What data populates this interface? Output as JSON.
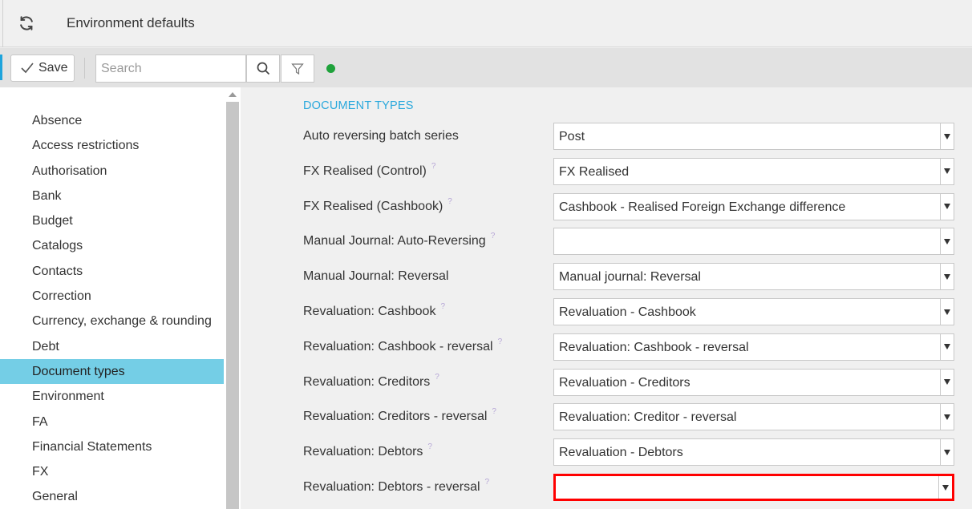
{
  "header": {
    "title": "Environment defaults",
    "refresh_icon": "refresh-icon"
  },
  "toolbar": {
    "save_label": "Save",
    "search_placeholder": "Search",
    "search_value": "",
    "status_color": "#1fa23b"
  },
  "sidebar": {
    "active_item": "Document types",
    "items": [
      {
        "label": "Absence"
      },
      {
        "label": "Access restrictions"
      },
      {
        "label": "Authorisation"
      },
      {
        "label": "Bank"
      },
      {
        "label": "Budget"
      },
      {
        "label": "Catalogs"
      },
      {
        "label": "Contacts"
      },
      {
        "label": "Correction"
      },
      {
        "label": "Currency, exchange & rounding"
      },
      {
        "label": "Debt"
      },
      {
        "label": "Document types"
      },
      {
        "label": "Environment"
      },
      {
        "label": "FA"
      },
      {
        "label": "Financial Statements"
      },
      {
        "label": "FX"
      },
      {
        "label": "General"
      }
    ]
  },
  "main": {
    "section_title": "DOCUMENT TYPES",
    "help_glyph": "?",
    "fields": [
      {
        "label": "Auto reversing batch series",
        "value": "Post",
        "help": false
      },
      {
        "label": "FX Realised (Control)",
        "value": "FX Realised",
        "help": true
      },
      {
        "label": "FX Realised (Cashbook)",
        "value": "Cashbook - Realised Foreign Exchange difference",
        "help": true
      },
      {
        "label": "Manual Journal: Auto-Reversing",
        "value": "",
        "help": true
      },
      {
        "label": "Manual Journal: Reversal",
        "value": "Manual journal: Reversal",
        "help": false
      },
      {
        "label": "Revaluation: Cashbook",
        "value": "Revaluation - Cashbook",
        "help": true
      },
      {
        "label": "Revaluation: Cashbook - reversal",
        "value": "Revaluation: Cashbook - reversal",
        "help": true
      },
      {
        "label": "Revaluation: Creditors",
        "value": "Revaluation - Creditors",
        "help": true
      },
      {
        "label": "Revaluation: Creditors - reversal",
        "value": "Revaluation: Creditor - reversal",
        "help": true
      },
      {
        "label": "Revaluation: Debtors",
        "value": "Revaluation - Debtors",
        "help": true
      },
      {
        "label": "Revaluation: Debtors - reversal",
        "value": "",
        "help": true,
        "highlighted": true
      }
    ]
  }
}
